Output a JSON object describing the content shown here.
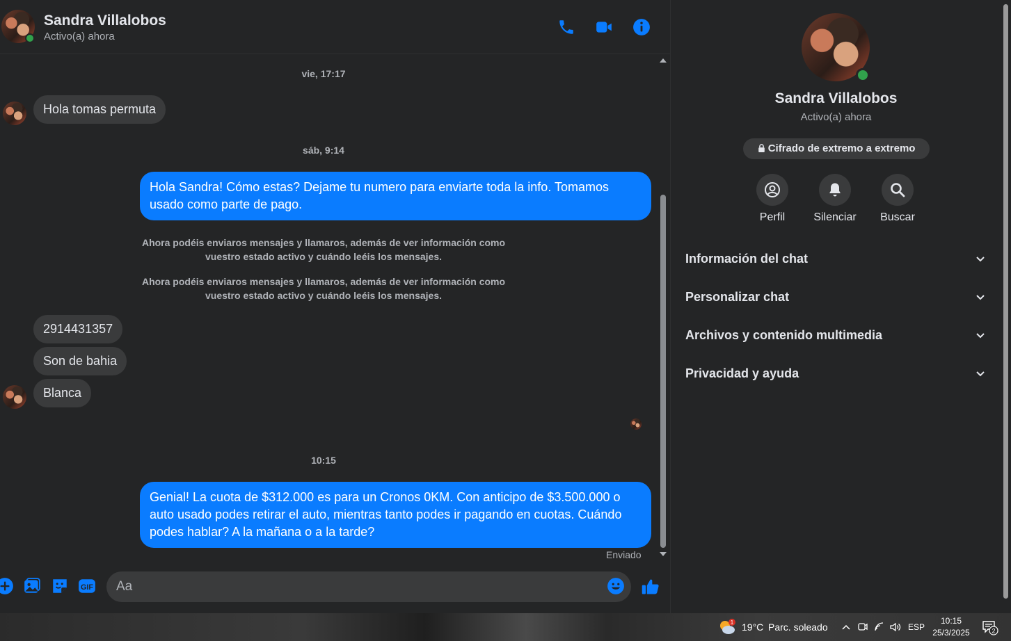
{
  "header": {
    "name": "Sandra Villalobos",
    "status": "Activo(a) ahora",
    "icons": [
      "phone-icon",
      "video-icon",
      "info-icon"
    ]
  },
  "messages": {
    "ts1": "vie, 17:17",
    "in1": "Hola tomas permuta",
    "ts2": "sáb, 9:14",
    "out1": "Hola Sandra! Cómo estas? Dejame tu numero para enviarte toda la info. Tomamos usado como parte de pago.",
    "sys1": "Ahora podéis enviaros mensajes y llamaros, además de ver información como vuestro estado activo y cuándo leéis los mensajes.",
    "sys2": "Ahora podéis enviaros mensajes y llamaros, además de ver información como vuestro estado activo y cuándo leéis los mensajes.",
    "in2": "2914431357",
    "in3": "Son de bahia",
    "in4": "Blanca",
    "ts3": "10:15",
    "out2": "Genial! La cuota de $312.000 es para un Cronos 0KM. Con anticipo de $3.500.000 o auto usado podes retirar el auto, mientras tanto podes ir pagando en cuotas. Cuándo podes hablar? A la mañana o a la tarde?",
    "sent": "Enviado"
  },
  "composer": {
    "placeholder": "Aa",
    "icons": [
      "plus-icon",
      "image-icon",
      "sticker-icon",
      "gif-icon",
      "emoji-icon",
      "thumbs-up-icon"
    ]
  },
  "info": {
    "name": "Sandra Villalobos",
    "status": "Activo(a) ahora",
    "encryption": "Cifrado de extremo a extremo",
    "actions": [
      {
        "label": "Perfil",
        "icon": "profile-icon"
      },
      {
        "label": "Silenciar",
        "icon": "bell-icon"
      },
      {
        "label": "Buscar",
        "icon": "search-icon"
      }
    ],
    "sections": [
      "Información del chat",
      "Personalizar chat",
      "Archivos y contenido multimedia",
      "Privacidad y ayuda"
    ]
  },
  "taskbar": {
    "weather_temp": "19°C",
    "weather_desc": "Parc. soleado",
    "weather_badge": "1",
    "language": "ESP",
    "time": "10:15",
    "date": "25/3/2025",
    "notifications": "2"
  },
  "colors": {
    "accent": "#0a7cff",
    "background": "#242526",
    "bubble_in": "#3a3b3c",
    "online": "#31a24c"
  }
}
